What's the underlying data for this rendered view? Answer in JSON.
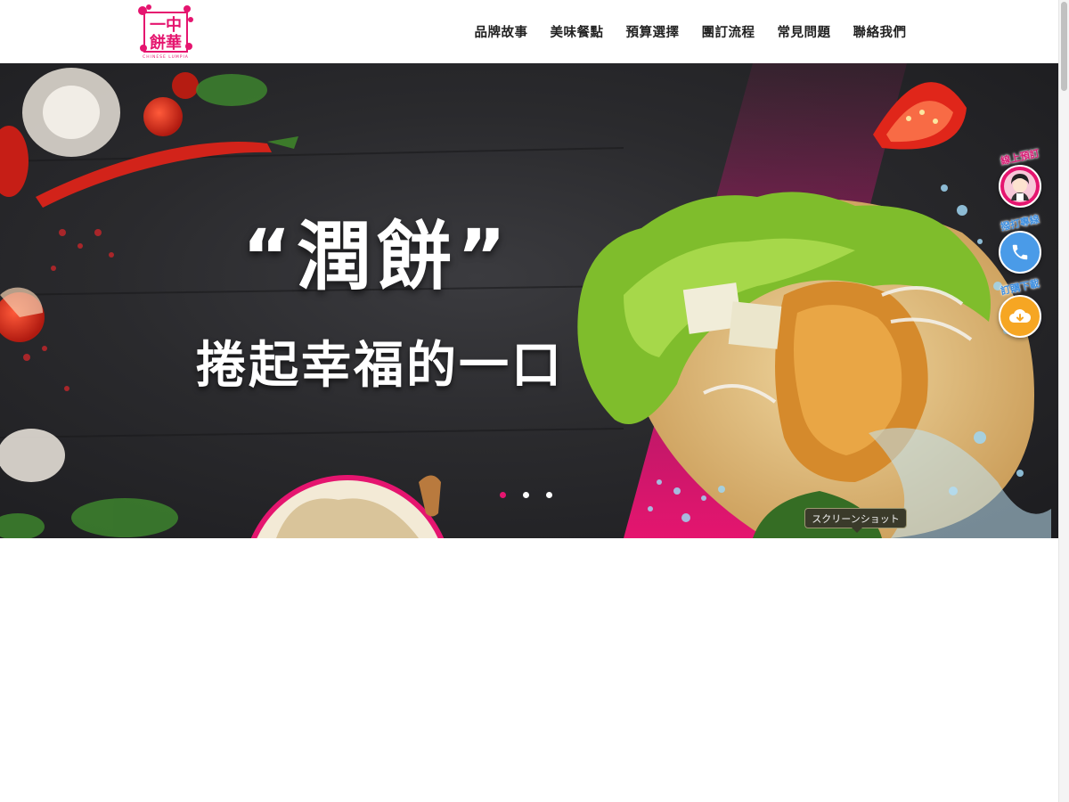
{
  "brand": {
    "logo_text_top": "一中",
    "logo_text_bottom": "餅華",
    "logo_subtext": "CHINESE LUMPIA",
    "color": "#e5156f"
  },
  "nav": [
    {
      "label": "品牌故事"
    },
    {
      "label": "美味餐點"
    },
    {
      "label": "預算選擇"
    },
    {
      "label": "團訂流程"
    },
    {
      "label": "常見問題"
    },
    {
      "label": "聯絡我們"
    }
  ],
  "hero": {
    "title": "“潤餅”",
    "subtitle": "捲起幸福的一口",
    "slides": 3,
    "active_slide": 0,
    "accent_color": "#e5156f"
  },
  "floating_buttons": [
    {
      "label": "線上預訂",
      "icon": "chef-girl-icon",
      "color": "#e5156f"
    },
    {
      "label": "撥打專線",
      "icon": "phone-icon",
      "color": "#4a9be8"
    },
    {
      "label": "訂購下載",
      "icon": "cloud-download-icon",
      "color": "#f6a623"
    }
  ],
  "tooltip": {
    "text": "スクリーンショット"
  }
}
